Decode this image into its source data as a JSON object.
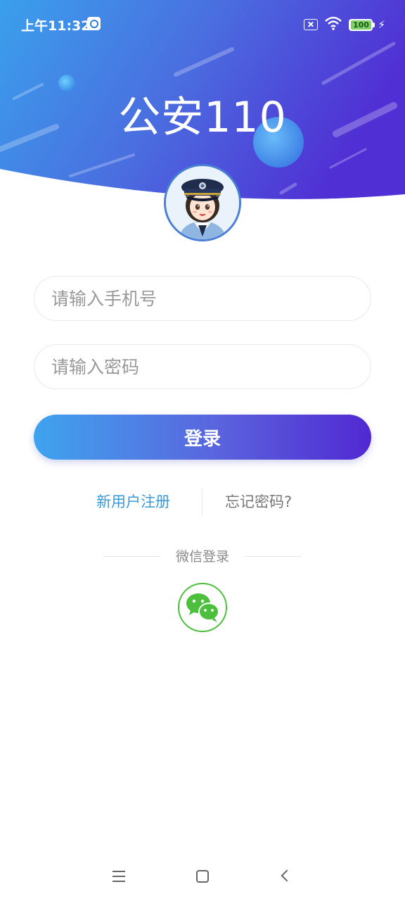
{
  "status_bar": {
    "time": "上午11:32",
    "battery": "100"
  },
  "header": {
    "title": "公安110"
  },
  "form": {
    "phone_placeholder": "请输入手机号",
    "password_placeholder": "请输入密码",
    "login_label": "登录"
  },
  "links": {
    "register": "新用户注册",
    "forgot": "忘记密码?"
  },
  "wechat": {
    "label": "微信登录"
  },
  "colors": {
    "accent_start": "#3fa4ef",
    "accent_end": "#5128d2",
    "link_blue": "#3a9ad9",
    "wechat_green": "#4cbf3c"
  },
  "icons": [
    "sim-off-icon",
    "wifi-icon",
    "battery-icon",
    "charging-icon",
    "police-avatar",
    "wechat-icon",
    "menu-icon",
    "home-icon",
    "back-icon"
  ]
}
